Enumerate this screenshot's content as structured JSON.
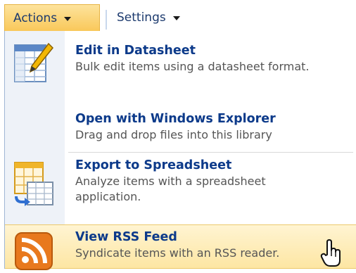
{
  "toolbar": {
    "actions_label": "Actions",
    "settings_label": "Settings"
  },
  "menu": {
    "items": [
      {
        "title": "Edit in Datasheet",
        "desc": "Bulk edit items using a datasheet format.",
        "icon": "datasheet-edit-icon"
      },
      {
        "title": "Open with Windows Explorer",
        "desc": "Drag and drop files into this library",
        "icon": "none"
      },
      {
        "title": "Export to Spreadsheet",
        "desc": "Analyze items with a spreadsheet application.",
        "icon": "spreadsheet-export-icon"
      },
      {
        "title": "View RSS Feed",
        "desc": "Syndicate items with an RSS reader.",
        "icon": "rss-icon"
      }
    ]
  },
  "colors": {
    "actions_tab": "#f9c85a",
    "link_title": "#0c3a8a",
    "hover_item": "#fde6a3",
    "rss_orange": "#e8791e"
  }
}
